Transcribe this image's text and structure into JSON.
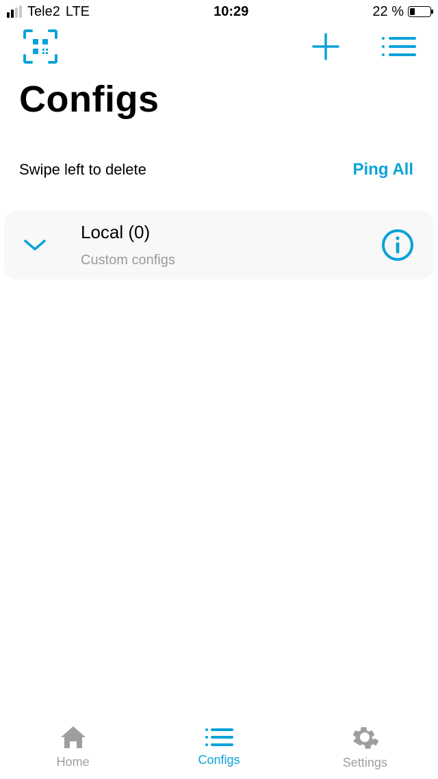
{
  "status_bar": {
    "carrier": "Tele2",
    "network": "LTE",
    "time": "10:29",
    "battery_pct": "22 %"
  },
  "header": {
    "title": "Configs"
  },
  "subrow": {
    "hint": "Swipe left to delete",
    "ping_all": "Ping All"
  },
  "card": {
    "title": "Local (0)",
    "subtitle": "Custom configs"
  },
  "tabs": {
    "home": "Home",
    "configs": "Configs",
    "settings": "Settings"
  },
  "colors": {
    "accent": "#0aa2d9",
    "muted": "#9e9e9e"
  }
}
